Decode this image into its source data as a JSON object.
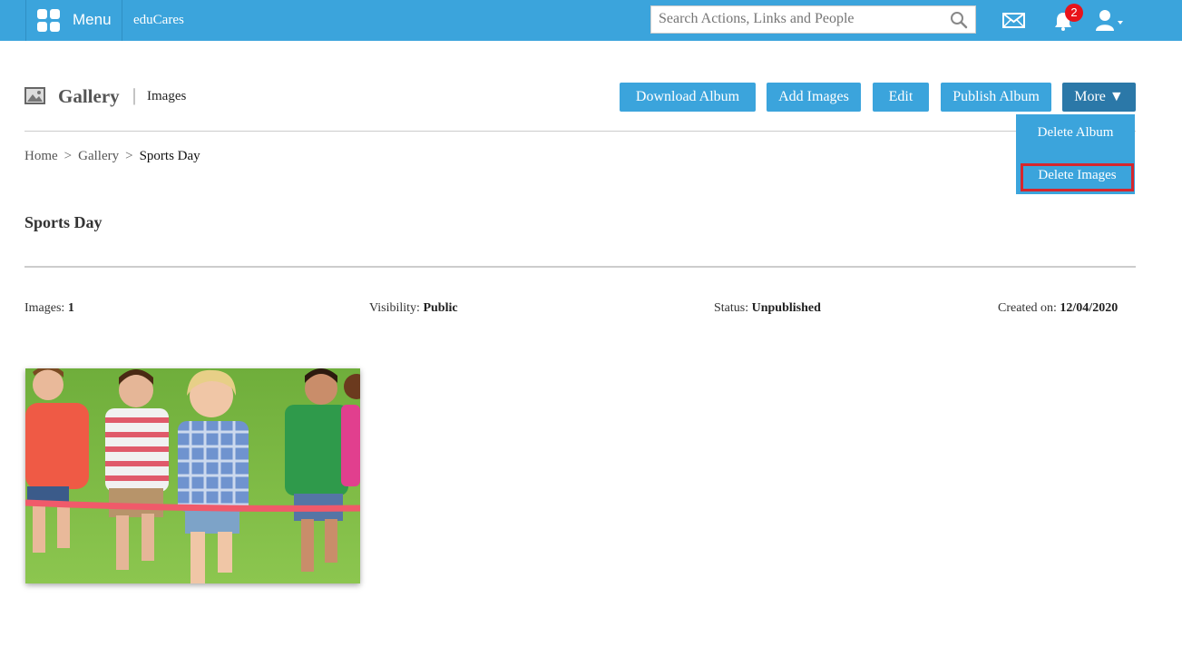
{
  "header": {
    "menu_label": "Menu",
    "brand": "eduCares",
    "search_placeholder": "Search Actions, Links and People",
    "notification_count": "2",
    "icons": [
      "menu-grid-icon",
      "search-icon",
      "mail-icon",
      "bell-icon",
      "user-icon"
    ]
  },
  "page": {
    "title": "Gallery",
    "separator": "|",
    "subtitle": "Images"
  },
  "toolbar": {
    "download_album": "Download Album",
    "add_images": "Add Images",
    "edit": "Edit",
    "publish_album": "Publish Album",
    "more": "More ▼"
  },
  "more_menu": {
    "items": [
      "Delete Album",
      "Delete Images"
    ],
    "highlighted": "Delete Images"
  },
  "breadcrumb": {
    "items": [
      "Home",
      "Gallery",
      "Sports Day"
    ],
    "separator": ">"
  },
  "album": {
    "title": "Sports Day",
    "images_label": "Images:",
    "images_count": "1",
    "visibility_label": "Visibility:",
    "visibility": "Public",
    "status_label": "Status:",
    "status": "Unpublished",
    "created_label": "Created on:",
    "created": "12/04/2020"
  },
  "colors": {
    "accent": "#3ba4dc",
    "more_button": "#2b78a8",
    "highlight_border": "#d6262d",
    "badge": "#e8141b"
  }
}
